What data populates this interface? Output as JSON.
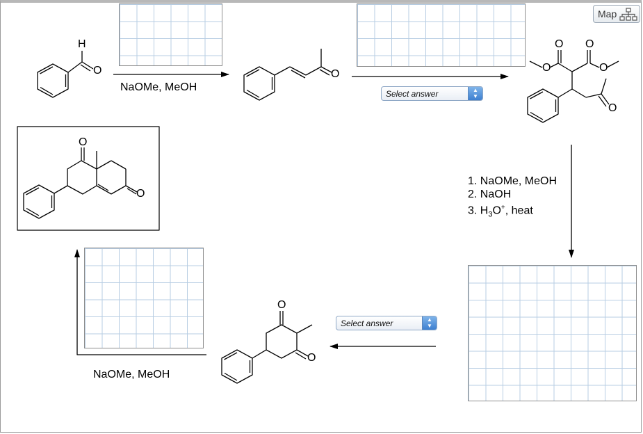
{
  "header": {
    "map_button_label": "Map",
    "map_icon": "sitemap-icon"
  },
  "reagents": {
    "step1": "NaOMe, MeOH",
    "step4_lines": [
      "1. NaOMe, MeOH",
      "2. NaOH",
      "3. H"
    ],
    "step4_line3_sub": "3",
    "step4_line3_mid": "O",
    "step4_line3_sup": "+",
    "step4_line3_end": ", heat",
    "step6": "NaOMe, MeOH"
  },
  "selects": {
    "step2": {
      "selected": "Select answer"
    },
    "step5": {
      "selected": "Select answer"
    }
  },
  "atom_labels": {
    "benzaldehyde_h": "H",
    "benzaldehyde_o": "O",
    "enone_o": "O",
    "diester_o1": "O",
    "diester_o2": "O",
    "diester_o3": "O",
    "diester_o4": "O",
    "diester_ketone_o": "O",
    "product_o1": "O",
    "product_o2": "O",
    "dione_o1": "O",
    "dione_o2": "O"
  },
  "colors": {
    "grid_line": "#b7cde3",
    "select_spin": "#3d7fd0"
  }
}
